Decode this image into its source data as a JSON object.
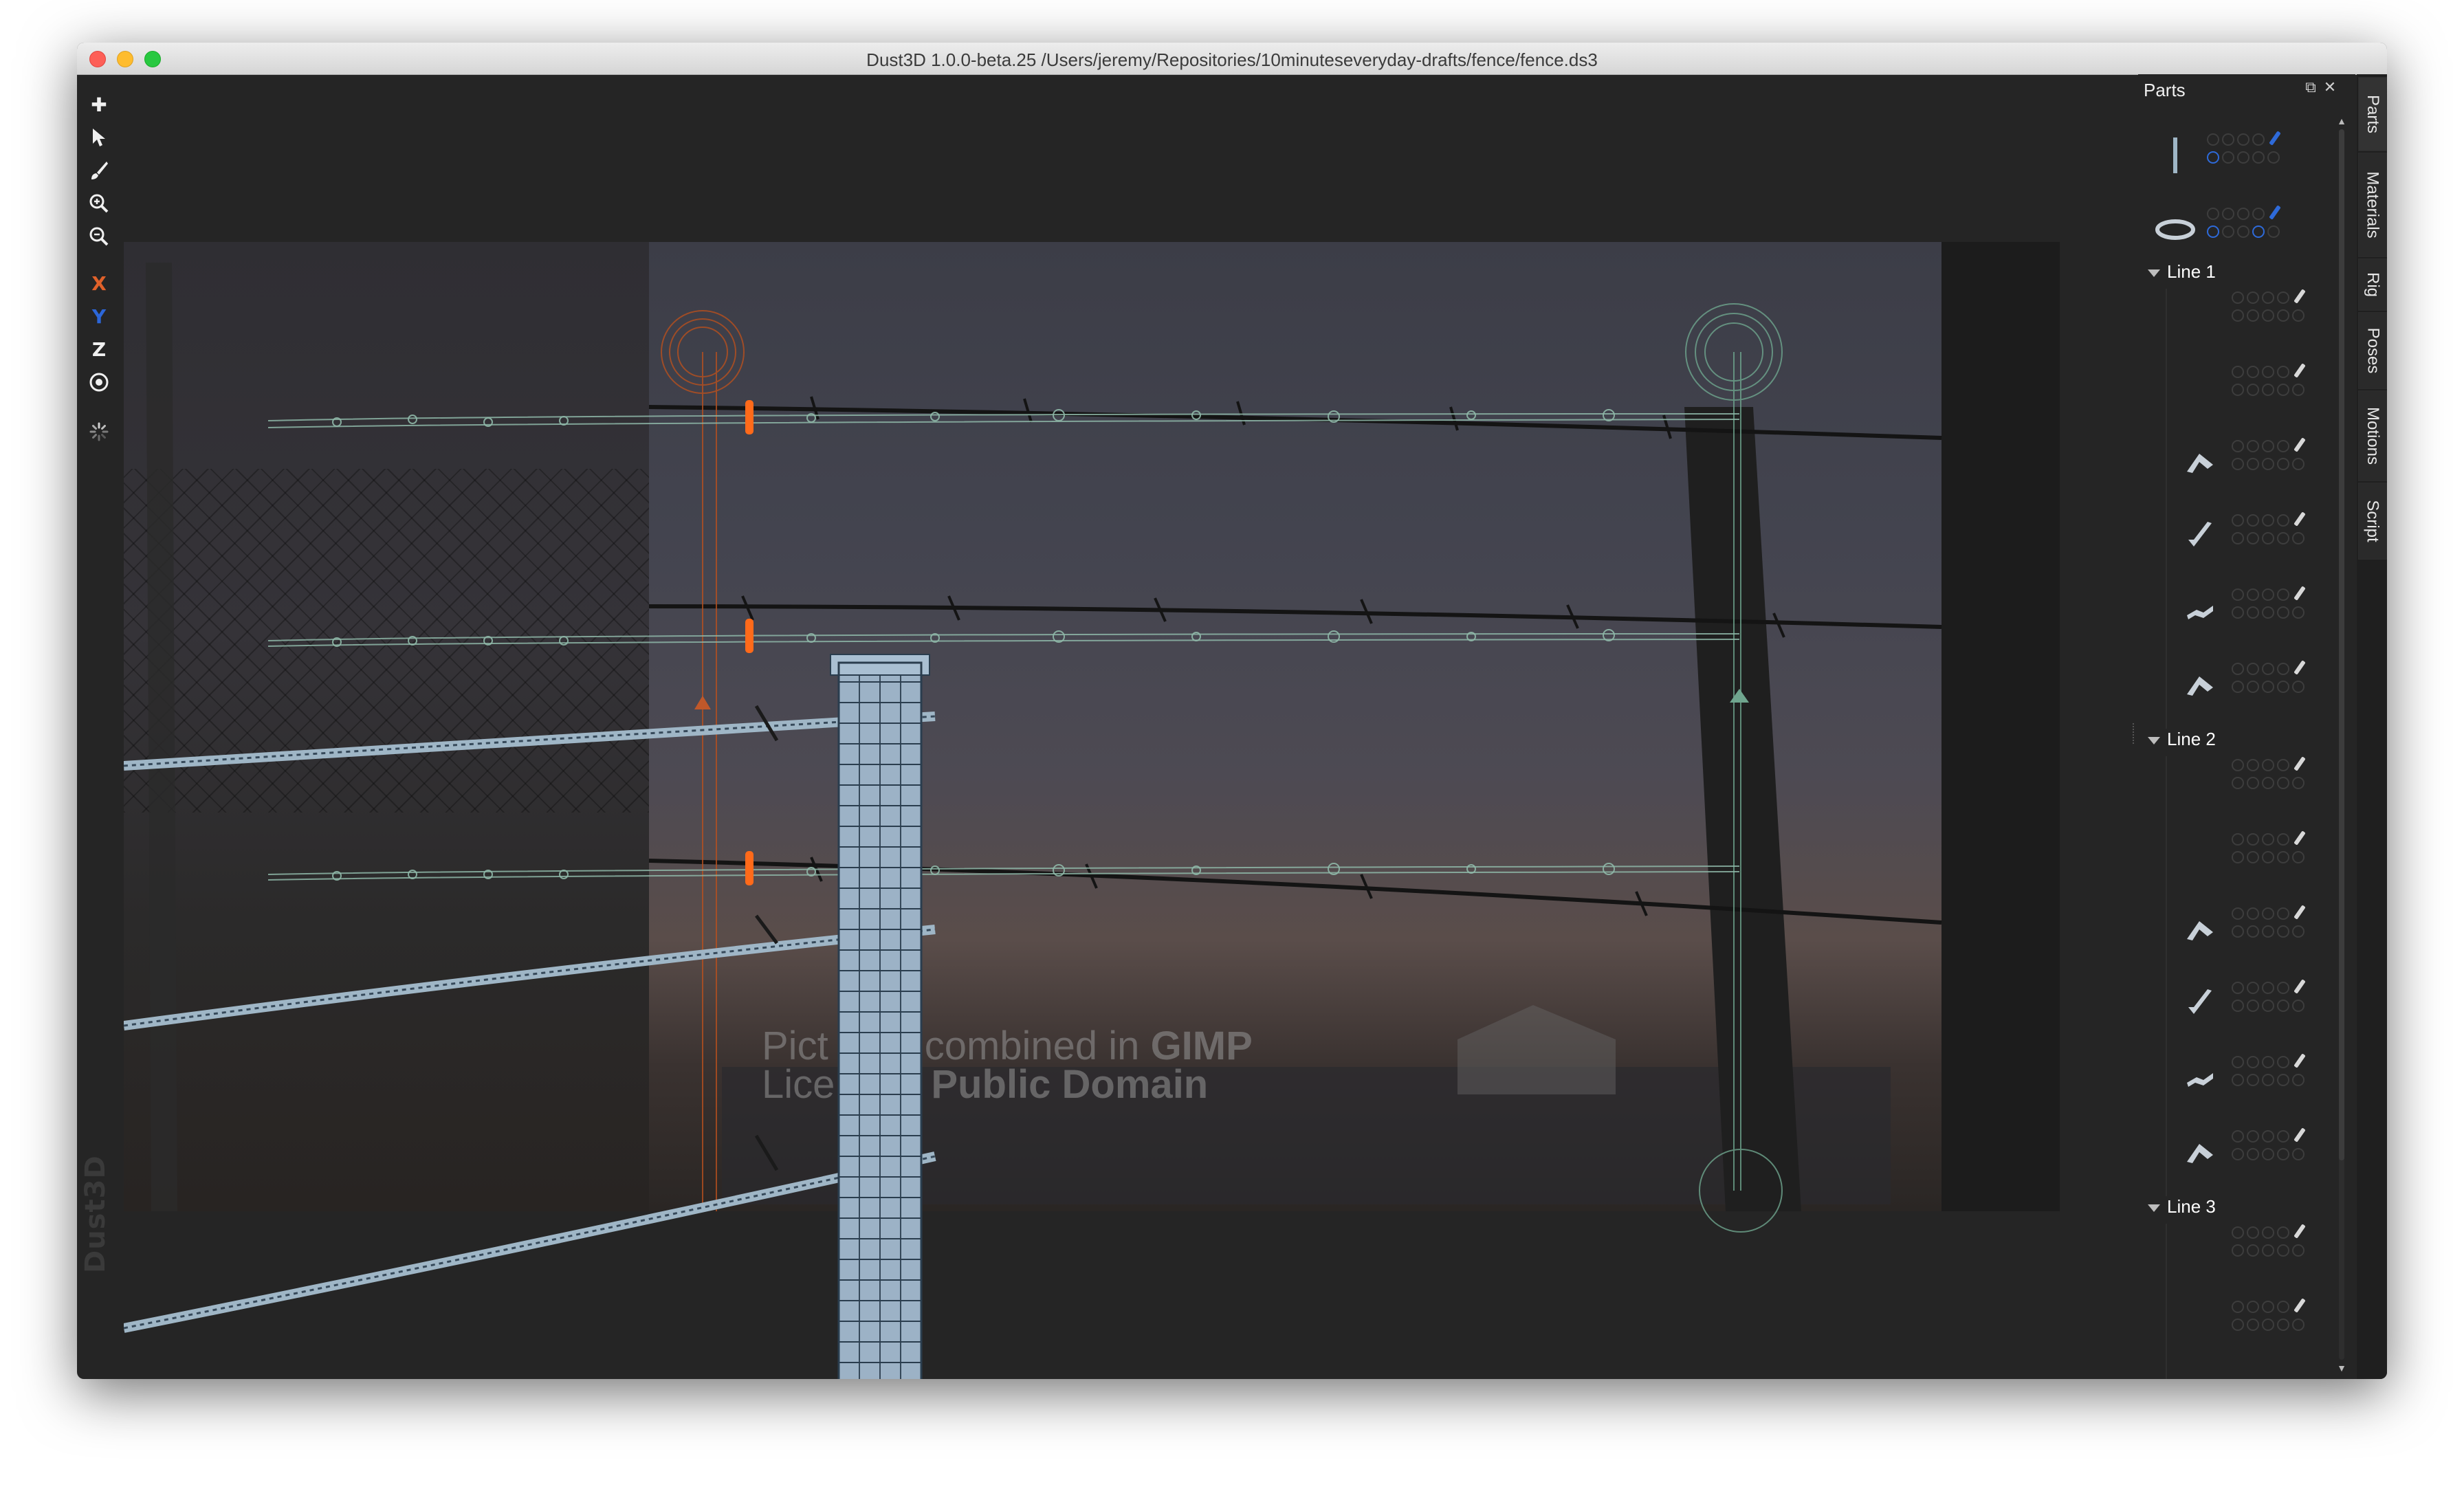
{
  "window": {
    "title": "Dust3D 1.0.0-beta.25 /Users/jeremy/Repositories/10minuteseveryday-drafts/fence/fence.ds3"
  },
  "toolbar": {
    "tools": [
      {
        "name": "add-icon",
        "glyph": "+"
      },
      {
        "name": "select-icon",
        "glyph": "⬉"
      },
      {
        "name": "paint-brush-icon",
        "glyph": "✎"
      },
      {
        "name": "zoom-in-icon",
        "glyph": "⊕"
      },
      {
        "name": "zoom-out-icon",
        "glyph": "⊖"
      }
    ],
    "axis_x": "X",
    "axis_y": "Y",
    "axis_z": "Z",
    "brand": "Dust3D"
  },
  "viewport": {
    "watermark_line1_a": "Pict",
    "watermark_line1_b": "combined in",
    "watermark_line1_c": "GIMP",
    "watermark_line2_a": "Lice",
    "watermark_line2_b": "Public Domain"
  },
  "panel": {
    "title": "Parts",
    "groups": [
      {
        "label": "Line 1"
      },
      {
        "label": "Line 2"
      },
      {
        "label": "Line 3"
      }
    ]
  },
  "sidetabs": [
    "Parts",
    "Materials",
    "Rig",
    "Poses",
    "Motions",
    "Script"
  ],
  "colors": {
    "accent_blue": "#2e6ad9",
    "axis_x": "#e0612a",
    "axis_y": "#2c66d8",
    "orange_marker": "#ff6a1a",
    "wire_node": "#8fb8a8"
  }
}
